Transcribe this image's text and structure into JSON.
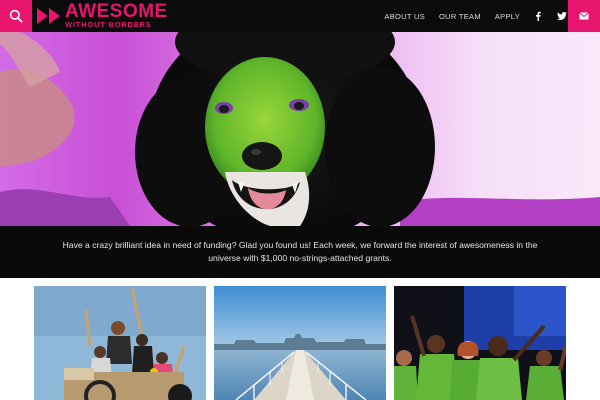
{
  "header": {
    "logo_main": "AWESOME",
    "logo_sub": "WITHOUT BORDERS",
    "nav": [
      "ABOUT US",
      "OUR TEAM",
      "APPLY"
    ],
    "search_icon": "search-icon",
    "social_icons": [
      "facebook-icon",
      "twitter-icon"
    ],
    "mail_icon": "mail-icon"
  },
  "hero": {
    "image": "dog-in-green-facepaint-with-fur-hood"
  },
  "banner": {
    "text": "Have a crazy brilliant idea in need of funding? Glad you found us! Each week, we forward the interest of awesomeness in the universe with $1,000 no-strings-attached grants."
  },
  "cards": [
    {
      "image": "kids-on-cardboard-cart"
    },
    {
      "image": "pier-city-skyline"
    },
    {
      "image": "singers-in-green-shirts"
    }
  ],
  "colors": {
    "brand": "#e8156f",
    "header_bg": "#0b0b0b",
    "banner_bg": "#0a0a0a",
    "banner_text": "#e6e6e6"
  }
}
